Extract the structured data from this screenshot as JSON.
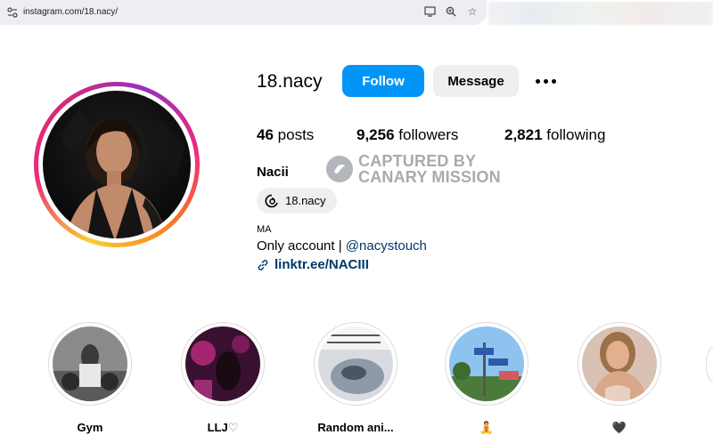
{
  "browser": {
    "url": "instagram.com/18.nacy/",
    "icons": [
      "site-settings-icon",
      "install-app-icon",
      "zoom-icon",
      "bookmark-star-icon"
    ]
  },
  "profile": {
    "username": "18.nacy",
    "follow_label": "Follow",
    "message_label": "Message",
    "posts_count": "46",
    "posts_label": "posts",
    "followers_count": "9,256",
    "followers_label": "followers",
    "following_count": "2,821",
    "following_label": "following",
    "display_name": "Nacii",
    "threads_handle": "18.nacy",
    "bio_small": "MA",
    "bio_text": "Only account |",
    "bio_mention": "@nacystouch",
    "link_text": "linktr.ee/NACIII"
  },
  "watermark": {
    "line1": "CAPTURED BY",
    "line2": "CANARY MISSION"
  },
  "highlights": [
    {
      "label": "Gym",
      "emoji": ""
    },
    {
      "label": "LLJ",
      "emoji": "♡"
    },
    {
      "label": "Random ani...",
      "emoji": ""
    },
    {
      "label": "",
      "emoji": "🧘"
    },
    {
      "label": "",
      "emoji": "🖤"
    }
  ],
  "colors": {
    "follow_button": "#0095f6",
    "message_button": "#efefef",
    "link": "#00376b"
  }
}
